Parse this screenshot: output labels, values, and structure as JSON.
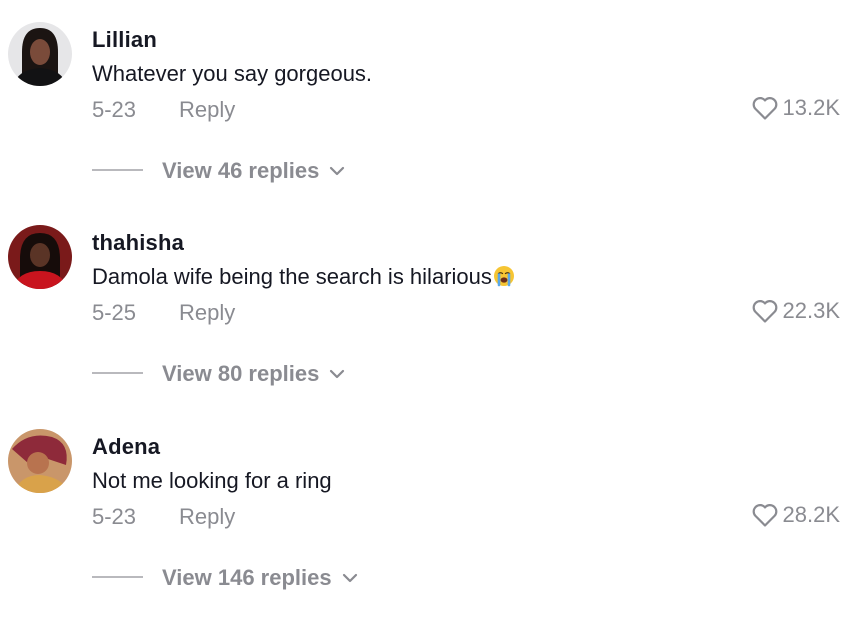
{
  "comments": [
    {
      "username": "Lillian",
      "text": "Whatever you say gorgeous.",
      "emoji": "",
      "date": "5-23",
      "reply_label": "Reply",
      "likes": "13.2K",
      "view_replies": "View 46 replies"
    },
    {
      "username": "thahisha",
      "text": "Damola wife being the search is hilarious",
      "emoji": "loudly-crying-face",
      "date": "5-25",
      "reply_label": "Reply",
      "likes": "22.3K",
      "view_replies": "View 80 replies"
    },
    {
      "username": "Adena",
      "text": "Not me looking for a ring",
      "emoji": "",
      "date": "5-23",
      "reply_label": "Reply",
      "likes": "28.2K",
      "view_replies": "View 146 replies"
    }
  ],
  "colors": {
    "primary_text": "#161823",
    "secondary_text": "#8a8b91",
    "background": "#ffffff"
  }
}
